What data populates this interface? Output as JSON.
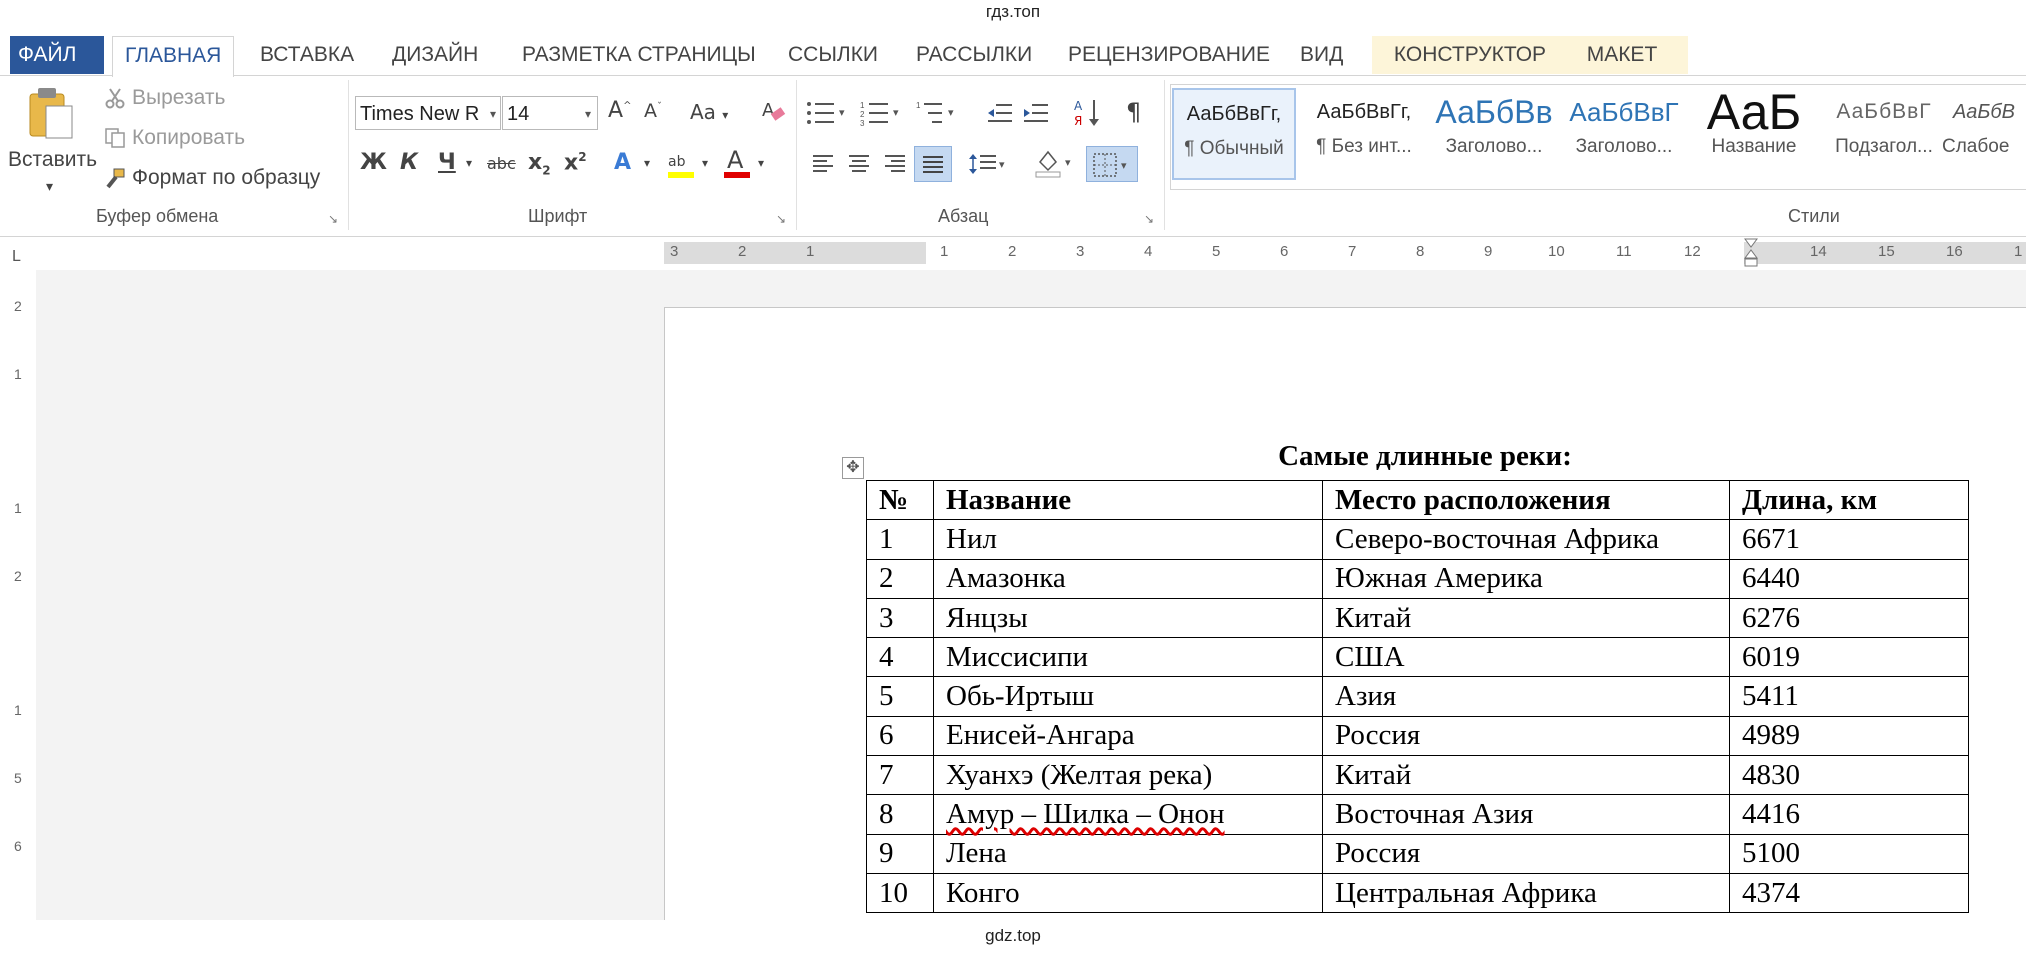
{
  "watermark_top": "гдз.топ",
  "watermark_bottom": "gdz.top",
  "tabs": [
    "ФАЙЛ",
    "ГЛАВНАЯ",
    "ВСТАВКА",
    "ДИЗАЙН",
    "РАЗМЕТКА СТРАНИЦЫ",
    "ССЫЛКИ",
    "РАССЫЛКИ",
    "РЕЦЕНЗИРОВАНИЕ",
    "ВИД",
    "КОНСТРУКТОР",
    "МАКЕТ"
  ],
  "clipboard": {
    "paste": "Вставить",
    "cut": "Вырезать",
    "copy": "Копировать",
    "format_painter": "Формат по образцу",
    "group_label": "Буфер обмена"
  },
  "font": {
    "name": "Times New R",
    "size": "14",
    "case": "Aa",
    "bold": "Ж",
    "italic": "К",
    "underline": "Ч",
    "strike": "abc",
    "group_label": "Шрифт"
  },
  "paragraph": {
    "pilcrow": "¶",
    "group_label": "Абзац"
  },
  "styles": {
    "group_label": "Стили",
    "items": [
      {
        "preview": "АаБбВвГг,",
        "label": "¶ Обычный"
      },
      {
        "preview": "АаБбВвГг,",
        "label": "¶ Без инт..."
      },
      {
        "preview": "АаБбВв",
        "label": "Заголово..."
      },
      {
        "preview": "АаБбВвГ",
        "label": "Заголово..."
      },
      {
        "preview": "АаБ",
        "label": "Название"
      },
      {
        "preview": "АаБбВвГ",
        "label": "Подзагол..."
      },
      {
        "preview": "АаБбВ",
        "label": "Слабое"
      }
    ]
  },
  "ruler": {
    "marks": [
      "3",
      "2",
      "1",
      "1",
      "2",
      "3",
      "4",
      "5",
      "6",
      "7",
      "8",
      "9",
      "10",
      "11",
      "12",
      "14",
      "15",
      "16",
      "1"
    ],
    "vmarks": [
      "2",
      "1",
      "1",
      "2",
      "1",
      "5",
      "6"
    ],
    "corner": "L"
  },
  "document": {
    "title": "Самые длинные реки:",
    "headers": [
      "№",
      "Название",
      "Место расположения",
      "Длина, км"
    ],
    "rows": [
      [
        "1",
        "Нил",
        "Северо-восточная Африка",
        "6671"
      ],
      [
        "2",
        "Амазонка",
        "Южная Америка",
        "6440"
      ],
      [
        "3",
        "Янцзы",
        "Китай",
        "6276"
      ],
      [
        "4",
        "Миссисипи",
        "США",
        "6019"
      ],
      [
        "5",
        "Обь-Иртыш",
        "Азия",
        "5411"
      ],
      [
        "6",
        "Енисей-Ангара",
        "Россия",
        "4989"
      ],
      [
        "7",
        "Хуанхэ (Желтая река)",
        "Китай",
        "4830"
      ],
      [
        "8",
        "Амур – Шилка – Онон",
        "Восточная Азия",
        "4416"
      ],
      [
        "9",
        "Лена",
        "Россия",
        "5100"
      ],
      [
        "10",
        "Конго",
        "Центральная Африка",
        "4374"
      ]
    ]
  },
  "colors": {
    "file_tab": "#2b579a",
    "context_tab": "#fdf5d9",
    "highlight_yellow": "#ffff00",
    "font_red": "#e00000"
  }
}
